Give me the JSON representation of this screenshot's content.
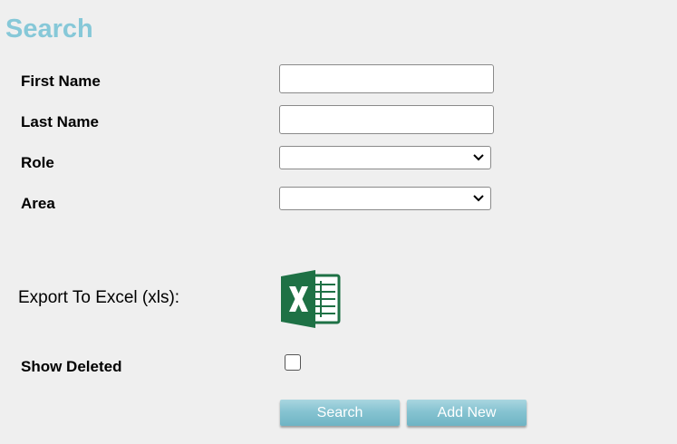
{
  "header": {
    "title": "Search"
  },
  "form": {
    "first_name": {
      "label": "First Name",
      "value": ""
    },
    "last_name": {
      "label": "Last Name",
      "value": ""
    },
    "role": {
      "label": "Role",
      "value": ""
    },
    "area": {
      "label": "Area",
      "value": ""
    },
    "export": {
      "label": "Export To Excel (xls):",
      "icon": "excel-icon",
      "icon_color": "#1e7145"
    },
    "show_deleted": {
      "label": "Show Deleted",
      "checked": false
    }
  },
  "actions": {
    "search_label": "Search",
    "add_new_label": "Add New"
  },
  "colors": {
    "title": "#86c8d8",
    "button": "#86c3d1",
    "background": "#efefef"
  }
}
